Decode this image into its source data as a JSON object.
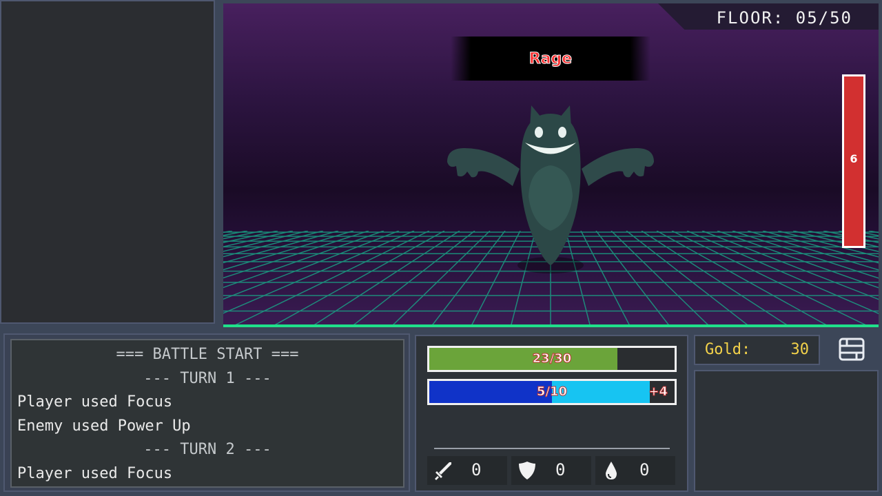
{
  "hud": {
    "floor": "FLOOR: 05/50",
    "status_effect": "Rage",
    "enemy_hp_value": "6"
  },
  "log": {
    "lines": [
      "=== BATTLE START ===",
      "--- TURN 1 ---",
      "Player used Focus",
      "Enemy used Power Up",
      "--- TURN 2 ---",
      "Player used Focus"
    ]
  },
  "player": {
    "hp_text": "23/30",
    "hp_fraction": 0.767,
    "mp_text": "5/10",
    "mp_fraction": 0.5,
    "mp_pending_fraction": 0.9,
    "mp_bonus": "+4",
    "stats": {
      "attack": "0",
      "defense": "0",
      "agility": "0"
    }
  },
  "gold": {
    "label": "Gold:",
    "value": "30"
  },
  "colors": {
    "hp": "#6ba43a",
    "mp": "#1033c8",
    "mp_pending": "#17c4f2",
    "enemy_hp": "#d23030",
    "gold": "#f3d24a",
    "grid": "#1fe08a"
  },
  "icons": [
    "sword-icon",
    "shield-icon",
    "drop-icon",
    "menu-icon"
  ]
}
